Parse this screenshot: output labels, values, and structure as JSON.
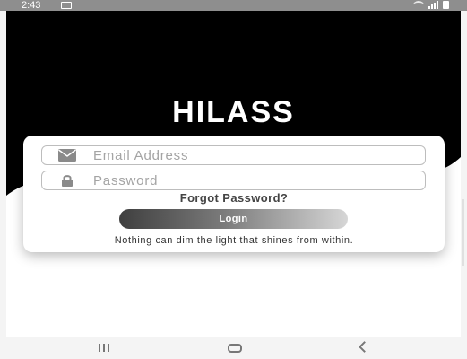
{
  "status_bar": {
    "time": "2:43"
  },
  "app": {
    "title": "HILASS"
  },
  "login": {
    "email_placeholder": "Email Address",
    "password_placeholder": "Password",
    "forgot_label": "Forgot Password?",
    "login_label": "Login",
    "quote": "Nothing can dim the light that shines from within."
  },
  "icons": {
    "email": "envelope-icon",
    "password": "lock-icon",
    "nav_recents": "recent-apps-icon",
    "nav_home": "home-icon",
    "nav_back": "back-icon"
  },
  "colors": {
    "hero": "#000000",
    "card": "#ffffff",
    "button_start": "#3f3f3f",
    "button_end": "#d6d6d6",
    "icon": "#8a8a8a"
  }
}
